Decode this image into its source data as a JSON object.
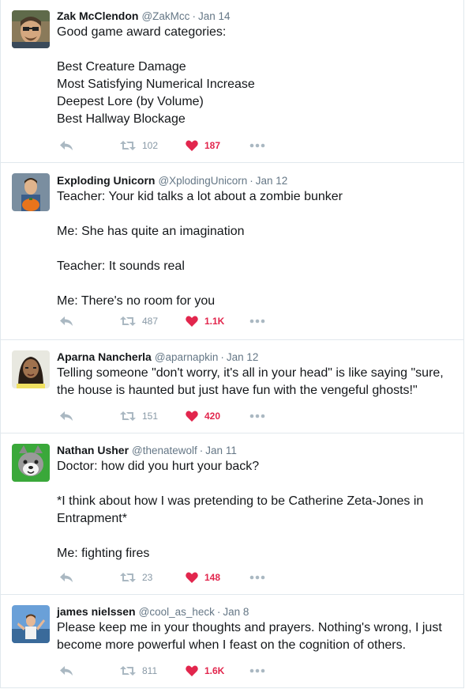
{
  "colors": {
    "like_red": "#e2264d",
    "muted_gray": "#8899a6",
    "divider": "#e1e8ed",
    "text": "#14171a"
  },
  "icons": {
    "reply": "reply-arrow-icon",
    "retweet": "retweet-icon",
    "like": "heart-icon",
    "more": "more-dots-icon"
  },
  "tweets": [
    {
      "name": "Zak McClendon",
      "handle": "@ZakMcc",
      "separator": "·",
      "date": "Jan 14",
      "lines": [
        "Good game award categories:",
        "",
        "Best Creature Damage",
        "Most Satisfying Numerical Increase",
        "Deepest Lore (by Volume)",
        "Best Hallway Blockage"
      ],
      "retweets": "102",
      "likes": "187"
    },
    {
      "name": "Exploding Unicorn",
      "handle": "@XplodingUnicorn",
      "separator": "·",
      "date": "Jan 12",
      "lines": [
        "Teacher: Your kid talks a lot about a zombie bunker",
        "",
        "Me: She has quite an imagination",
        "",
        "Teacher: It sounds real",
        "",
        "Me: There's no room for you"
      ],
      "retweets": "487",
      "likes": "1.1K"
    },
    {
      "name": "Aparna Nancherla",
      "handle": "@aparnapkin",
      "separator": "·",
      "date": "Jan 12",
      "lines": [
        "Telling someone \"don't worry, it's all in your head\" is like saying \"sure,",
        "the house is haunted but just have fun with the vengeful ghosts!\""
      ],
      "retweets": "151",
      "likes": "420"
    },
    {
      "name": "Nathan Usher",
      "handle": "@thenatewolf",
      "separator": "·",
      "date": "Jan 11",
      "lines": [
        "Doctor: how did you hurt your back?",
        "",
        "*I think about how I was pretending to be Catherine Zeta-Jones in",
        "Entrapment*",
        "",
        "Me: fighting fires"
      ],
      "retweets": "23",
      "likes": "148"
    },
    {
      "name": "james nielssen",
      "handle": "@cool_as_heck",
      "separator": "·",
      "date": "Jan 8",
      "lines": [
        "Please keep me in your thoughts and prayers. Nothing's wrong, I just",
        "become more powerful when I feast on the cognition of others."
      ],
      "retweets": "811",
      "likes": "1.6K"
    }
  ]
}
